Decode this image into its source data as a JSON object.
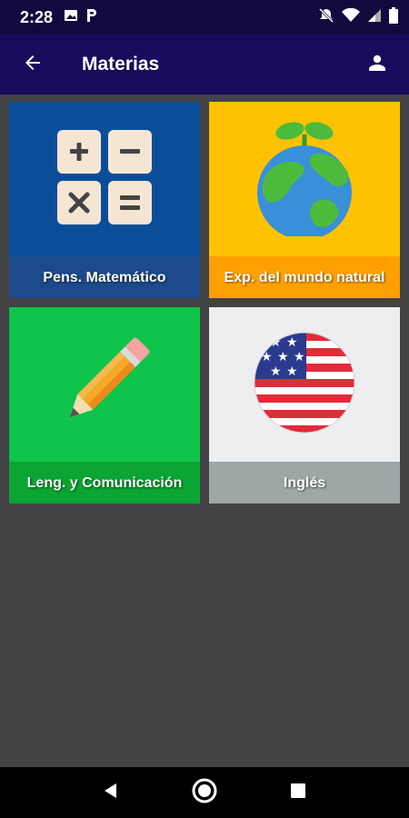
{
  "status_bar": {
    "time": "2:28",
    "left_icons": [
      "image-icon",
      "parking-p-icon"
    ],
    "right_icons": [
      "mute-icon",
      "wifi-icon",
      "signal-icon",
      "battery-icon"
    ]
  },
  "app_bar": {
    "title": "Materias",
    "back_icon": "arrow-back-icon",
    "account_icon": "person-icon",
    "color": "#1a0a5e"
  },
  "subjects": [
    {
      "label": "Pens. Matemático",
      "icon": "calculator-icon",
      "bg": "#0a4e9a",
      "label_bg": "#1c4a8a"
    },
    {
      "label": "Exp. del mundo natural",
      "icon": "globe-plant-icon",
      "bg": "#ffc200",
      "label_bg": "#ffa000"
    },
    {
      "label": "Leng. y Comunicación",
      "icon": "pencil-icon",
      "bg": "#0fc44a",
      "label_bg": "#0aa532"
    },
    {
      "label": "Inglés",
      "icon": "us-flag-icon",
      "bg": "#eceef0",
      "label_bg": "#9ea6a6"
    }
  ],
  "nav_bar": {
    "buttons": [
      "back-triangle-icon",
      "home-circle-icon",
      "recents-square-icon"
    ]
  }
}
